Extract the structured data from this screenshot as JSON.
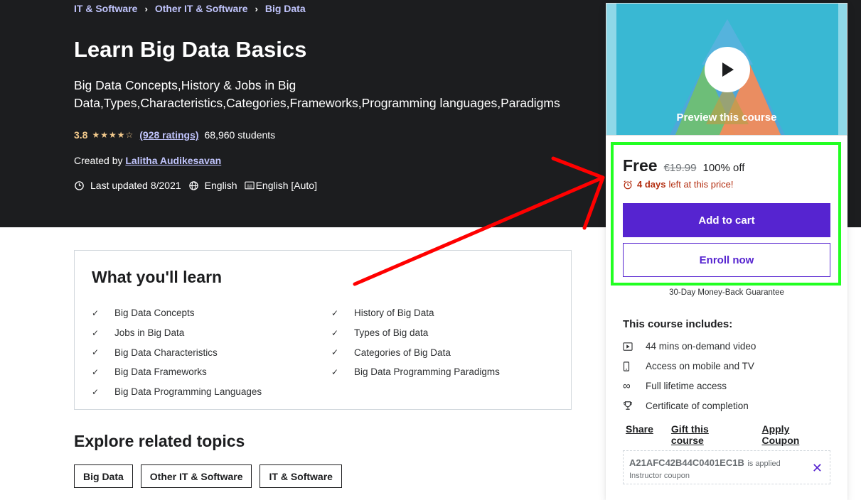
{
  "breadcrumb": [
    "IT & Software",
    "Other IT & Software",
    "Big Data"
  ],
  "course": {
    "title": "Learn Big Data Basics",
    "subtitle": "Big Data Concepts,History & Jobs in Big Data,Types,Characteristics,Categories,Frameworks,Programming languages,Paradigms",
    "rating": "3.8",
    "ratings_count": "(928 ratings)",
    "students": "68,960 students",
    "created_by_label": "Created by",
    "author": "Lalitha Audikesavan",
    "last_updated": "Last updated 8/2021",
    "language": "English",
    "captions": "English [Auto]"
  },
  "learn": {
    "title": "What you'll learn",
    "left": [
      "Big Data Concepts",
      "Jobs in Big Data",
      "Big Data Characteristics",
      "Big Data Frameworks",
      "Big Data Programming Languages"
    ],
    "right": [
      "History of Big Data",
      "Types of Big data",
      "Categories of Big Data",
      "Big Data Programming Paradigms"
    ]
  },
  "explore": {
    "title": "Explore related topics",
    "topics": [
      "Big Data",
      "Other IT & Software",
      "IT & Software"
    ]
  },
  "sidebar": {
    "preview_label": "Preview this course",
    "price_free": "Free",
    "price_original": "€19.99",
    "discount": "100% off",
    "timer_days": "4 days",
    "timer_rest": "left at this price!",
    "add_to_cart": "Add to cart",
    "enroll_now": "Enroll now",
    "guarantee": "30-Day Money-Back Guarantee",
    "includes_title": "This course includes:",
    "includes": [
      {
        "icon": "video-icon",
        "text": "44 mins on-demand video"
      },
      {
        "icon": "mobile-icon",
        "text": "Access on mobile and TV"
      },
      {
        "icon": "infinity-icon",
        "text": "Full lifetime access"
      },
      {
        "icon": "trophy-icon",
        "text": "Certificate of completion"
      }
    ],
    "links": [
      "Share",
      "Gift this course",
      "Apply Coupon"
    ],
    "coupon_code": "A21AFC42B44C0401EC1B",
    "coupon_applied": "is applied",
    "coupon_sub": "Instructor coupon"
  },
  "colors": {
    "hero_bg": "#1c1d1f",
    "accent_purple": "#5624d0",
    "link_lavender": "#c0c4fc",
    "star_gold": "#f3ca8c",
    "highlight_green": "#22ff22",
    "arrow_red": "#ff0000"
  }
}
